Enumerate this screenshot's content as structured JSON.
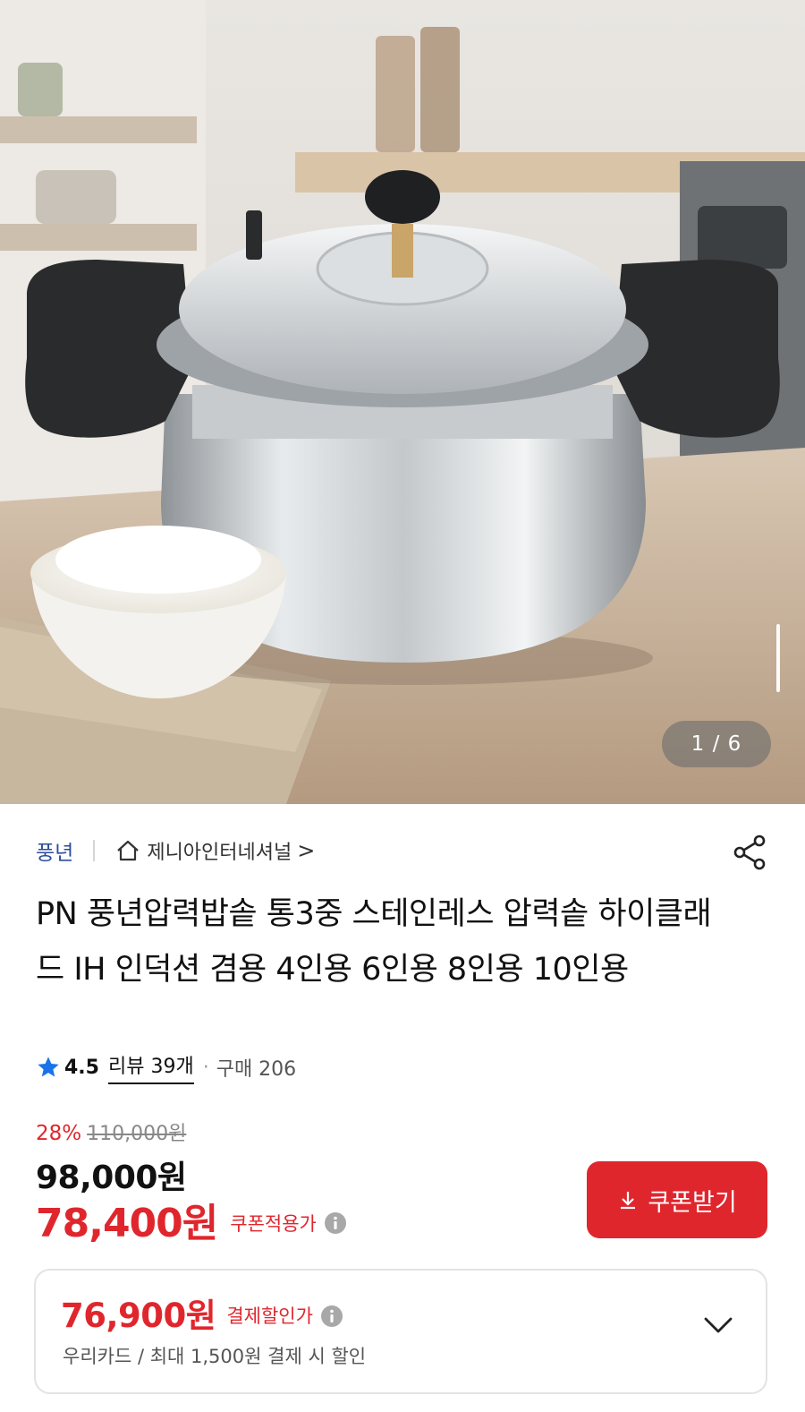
{
  "gallery": {
    "current_page": "1",
    "separator": "/",
    "total_pages": "6",
    "counter_text": "1 / 6"
  },
  "seller": {
    "brand": "풍년",
    "store_name": "제니아인터네셔널",
    "store_chevron": ">"
  },
  "product": {
    "title": "PN 풍년압력밥솥 통3중 스테인레스 압력솥 하이클래드 IH 인덕션 겸용 4인용 6인용 8인용 10인용"
  },
  "rating": {
    "score": "4.5",
    "review_text": "리뷰 39개",
    "separator": "·",
    "purchase_text": "구매 206"
  },
  "price": {
    "discount_rate": "28%",
    "original_price": "110,000원",
    "sale_price": "98,000원",
    "coupon_price": "78,400원",
    "coupon_price_label": "쿠폰적용가"
  },
  "coupon_button": {
    "label": "쿠폰받기"
  },
  "payment": {
    "price": "76,900원",
    "label": "결제할인가",
    "description": "우리카드 / 최대 1,500원 결제 시 할인"
  },
  "colors": {
    "accent_red": "#e0262d",
    "brand_blue": "#2b4d9c",
    "star_blue": "#1a73e8"
  },
  "icons": [
    "home-icon",
    "share-icon",
    "star-icon",
    "info-icon",
    "download-icon",
    "chevron-down-icon"
  ]
}
